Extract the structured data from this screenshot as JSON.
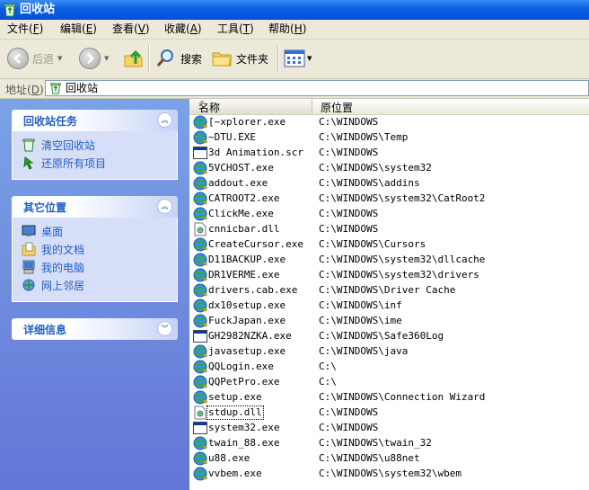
{
  "window": {
    "title": "回收站"
  },
  "menu": [
    {
      "label": "文件",
      "key": "F"
    },
    {
      "label": "编辑",
      "key": "E"
    },
    {
      "label": "查看",
      "key": "V"
    },
    {
      "label": "收藏",
      "key": "A"
    },
    {
      "label": "工具",
      "key": "T"
    },
    {
      "label": "帮助",
      "key": "H"
    }
  ],
  "toolbar": {
    "back": "后退",
    "search": "搜索",
    "folders": "文件夹"
  },
  "address": {
    "label": "地址",
    "key": "D",
    "value": "回收站"
  },
  "tasks": {
    "title": "回收站任务",
    "items": [
      "清空回收站",
      "还原所有项目"
    ]
  },
  "places": {
    "title": "其它位置",
    "items": [
      "桌面",
      "我的文档",
      "我的电脑",
      "网上邻居"
    ]
  },
  "details": {
    "title": "详细信息"
  },
  "columns": {
    "name": "名称",
    "location": "原位置"
  },
  "files": [
    {
      "name": "[~xplorer.exe",
      "path": "C:\\WINDOWS",
      "icon": "globe"
    },
    {
      "name": "~DTU.EXE",
      "path": "C:\\WINDOWS\\Temp",
      "icon": "globe"
    },
    {
      "name": "3d Animation.scr",
      "path": "C:\\WINDOWS",
      "icon": "window"
    },
    {
      "name": "5VCHOST.exe",
      "path": "C:\\WINDOWS\\system32",
      "icon": "globe"
    },
    {
      "name": "addout.exe",
      "path": "C:\\WINDOWS\\addins",
      "icon": "globe"
    },
    {
      "name": "CATROOT2.exe",
      "path": "C:\\WINDOWS\\system32\\CatRoot2",
      "icon": "globe"
    },
    {
      "name": "ClickMe.exe",
      "path": "C:\\WINDOWS",
      "icon": "globe"
    },
    {
      "name": "cnnicbar.dll",
      "path": "C:\\WINDOWS",
      "icon": "dll"
    },
    {
      "name": "CreateCursor.exe",
      "path": "C:\\WINDOWS\\Cursors",
      "icon": "globe"
    },
    {
      "name": "D11BACKUP.exe",
      "path": "C:\\WINDOWS\\system32\\dllcache",
      "icon": "globe"
    },
    {
      "name": "DR1VERME.exe",
      "path": "C:\\WINDOWS\\system32\\drivers",
      "icon": "globe"
    },
    {
      "name": "drivers.cab.exe",
      "path": "C:\\WINDOWS\\Driver Cache",
      "icon": "globe"
    },
    {
      "name": "dx10setup.exe",
      "path": "C:\\WINDOWS\\inf",
      "icon": "globe"
    },
    {
      "name": "FuckJapan.exe",
      "path": "C:\\WINDOWS\\ime",
      "icon": "globe"
    },
    {
      "name": "GH2982NZKA.exe",
      "path": "C:\\WINDOWS\\Safe360Log",
      "icon": "window"
    },
    {
      "name": "javasetup.exe",
      "path": "C:\\WINDOWS\\java",
      "icon": "globe"
    },
    {
      "name": "QQLogin.exe",
      "path": "C:\\",
      "icon": "globe"
    },
    {
      "name": "QQPetPro.exe",
      "path": "C:\\",
      "icon": "globe"
    },
    {
      "name": "setup.exe",
      "path": "C:\\WINDOWS\\Connection Wizard",
      "icon": "globe"
    },
    {
      "name": "stdup.dll",
      "path": "C:\\WINDOWS",
      "icon": "dll"
    },
    {
      "name": "system32.exe",
      "path": "C:\\WINDOWS",
      "icon": "window"
    },
    {
      "name": "twain_88.exe",
      "path": "C:\\WINDOWS\\twain_32",
      "icon": "globe"
    },
    {
      "name": "u88.exe",
      "path": "C:\\WINDOWS\\u88net",
      "icon": "globe"
    },
    {
      "name": "vvbem.exe",
      "path": "C:\\WINDOWS\\system32\\wbem",
      "icon": "globe"
    }
  ]
}
